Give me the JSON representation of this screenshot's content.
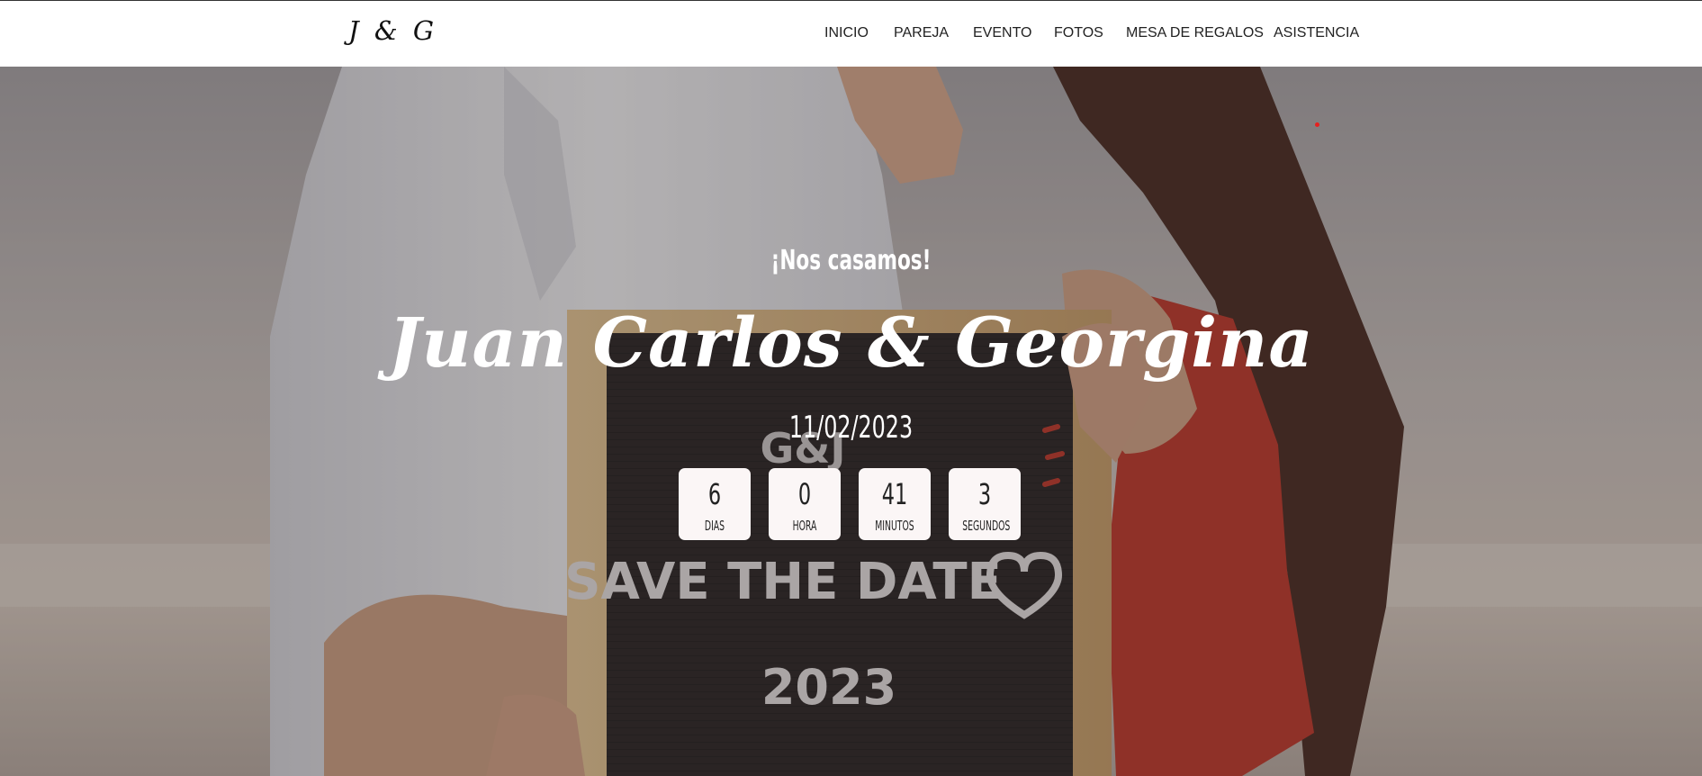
{
  "header": {
    "brand": "J & G",
    "nav": [
      "INICIO",
      "PAREJA",
      "EVENTO",
      "FOTOS",
      "MESA DE REGALOS",
      "ASISTENCIA"
    ]
  },
  "hero": {
    "subtitle": "¡Nos casamos!",
    "names": "Juan Carlos & Georgina",
    "date": "11/02/2023",
    "countdown": [
      {
        "value": "6",
        "label": "Dias"
      },
      {
        "value": "0",
        "label": "Hora"
      },
      {
        "value": "41",
        "label": "Minutos"
      },
      {
        "value": "3",
        "label": "Segundos"
      }
    ],
    "board_text": {
      "initials": "G&J",
      "line": "SAVE THE DATE",
      "year": "2023"
    }
  },
  "colors": {
    "nav_background": "#ffffff",
    "countdown_box": "#fbf6f6",
    "dress_red": "#c0392b",
    "accent_dot": "#e6201f"
  }
}
